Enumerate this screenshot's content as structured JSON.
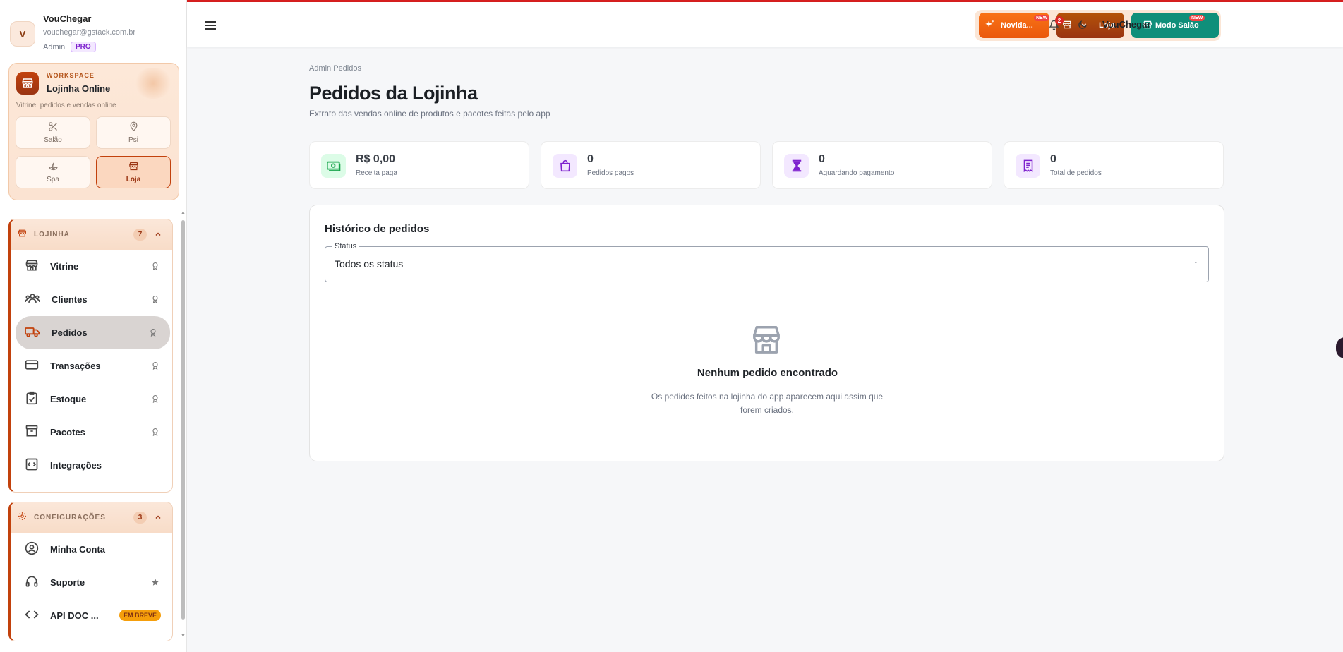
{
  "user": {
    "initial": "V",
    "name": "VouChegar",
    "email": "vouchegar@gstack.com.br",
    "role": "Admin",
    "plan_badge": "PRO"
  },
  "workspace": {
    "kicker": "WORKSPACE",
    "title": "Lojinha Online",
    "description": "Vitrine, pedidos e vendas online",
    "modes": [
      {
        "label": "Salão",
        "icon": "scissors-icon",
        "active": false
      },
      {
        "label": "Psi",
        "icon": "location-pin-icon",
        "active": false
      },
      {
        "label": "Spa",
        "icon": "lotus-icon",
        "active": false
      },
      {
        "label": "Loja",
        "icon": "storefront-icon",
        "active": true
      }
    ]
  },
  "sidebar": {
    "sections": [
      {
        "label": "LOJINHA",
        "count": "7",
        "items": [
          {
            "label": "Vitrine",
            "icon": "storefront-icon",
            "trailing": "award-icon",
            "active": false
          },
          {
            "label": "Clientes",
            "icon": "users-icon",
            "trailing": "award-icon",
            "active": false
          },
          {
            "label": "Pedidos",
            "icon": "truck-icon",
            "trailing": "award-icon",
            "active": true
          },
          {
            "label": "Transações",
            "icon": "credit-card-icon",
            "trailing": "award-icon",
            "active": false
          },
          {
            "label": "Estoque",
            "icon": "clipboard-check-icon",
            "trailing": "award-icon",
            "active": false
          },
          {
            "label": "Pacotes",
            "icon": "archive-icon",
            "trailing": "award-icon",
            "active": false
          },
          {
            "label": "Integrações",
            "icon": "code-box-icon",
            "trailing": "",
            "active": false
          }
        ]
      },
      {
        "label": "CONFIGURAÇÕES",
        "count": "3",
        "items": [
          {
            "label": "Minha Conta",
            "icon": "user-circle-icon",
            "trailing": "",
            "active": false
          },
          {
            "label": "Suporte",
            "icon": "headset-icon",
            "trailing": "star-icon",
            "active": false
          },
          {
            "label": "API DOC ...",
            "icon": "code-icon",
            "trailing": "",
            "badge": "EM BREVE",
            "active": false
          }
        ]
      }
    ]
  },
  "topbar": {
    "buttons": [
      {
        "label": "Novida...",
        "new_badge": "NEW",
        "color": "#ea580c"
      },
      {
        "label": "Loja",
        "new_badge": "",
        "color": "#9a3412"
      },
      {
        "label": "Modo Salão",
        "new_badge": "NEW",
        "color": "#0f8f7a"
      }
    ],
    "notifications_count": "2",
    "username": "VouChegar"
  },
  "page": {
    "breadcrumb": "Admin Pedidos",
    "title": "Pedidos da Lojinha",
    "subtitle": "Extrato das vendas online de produtos e pacotes feitas pelo app"
  },
  "stats": [
    {
      "value": "R$ 0,00",
      "label": "Receita paga",
      "icon": "cash-icon",
      "color": "#16a34a"
    },
    {
      "value": "0",
      "label": "Pedidos pagos",
      "icon": "shopping-bag-icon",
      "color": "#7e22ce"
    },
    {
      "value": "0",
      "label": "Aguardando pagamento",
      "icon": "hourglass-icon",
      "color": "#7e22ce"
    },
    {
      "value": "0",
      "label": "Total de pedidos",
      "icon": "receipt-icon",
      "color": "#7e22ce"
    }
  ],
  "history": {
    "title": "Histórico de pedidos",
    "status_legend": "Status",
    "status_value": "Todos os status",
    "empty_title": "Nenhum pedido encontrado",
    "empty_description": "Os pedidos feitos na lojinha do app aparecem aqui assim que forem criados."
  },
  "colors": {
    "accent": "#c2410c",
    "top_line": "#d61f1f",
    "teal": "#0f8f7a"
  }
}
